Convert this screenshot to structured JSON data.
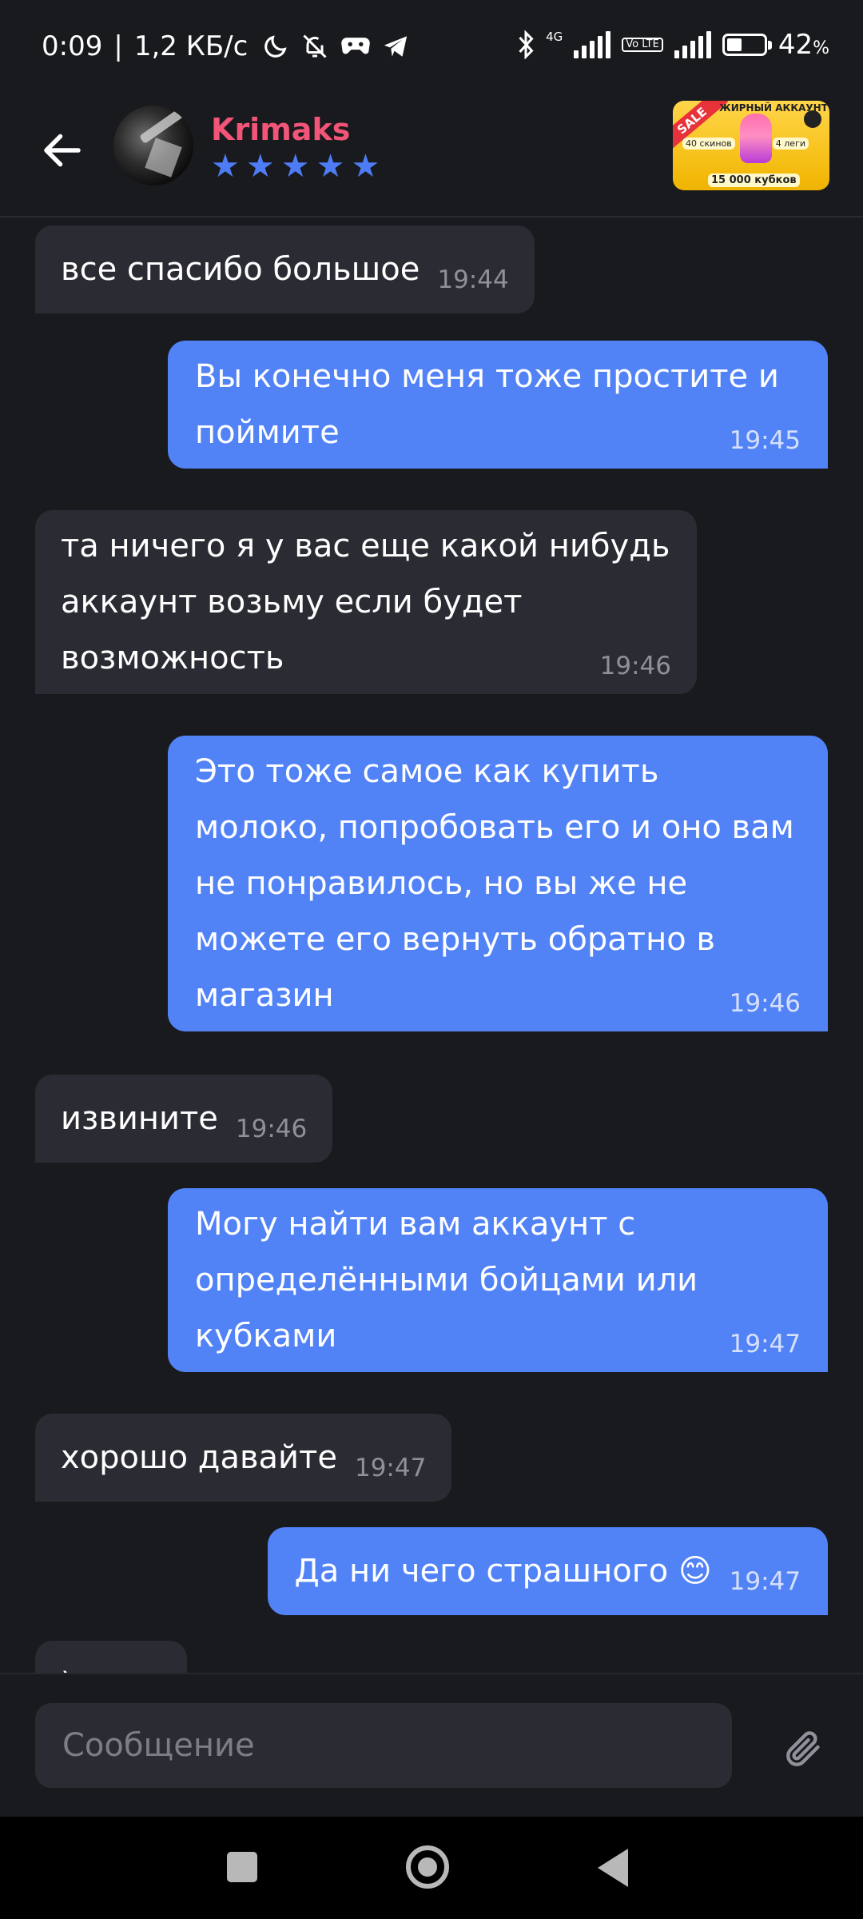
{
  "status_bar": {
    "time": "0:09",
    "separator": "|",
    "speed": "1,2 КБ/с",
    "network": "4G",
    "volte": "Vo LTE",
    "battery_percent": "42",
    "battery_percent_sign": "%",
    "battery_level": 0.42,
    "icons": [
      "moon-icon",
      "bell-off-icon",
      "gamepad-icon",
      "telegram-icon",
      "bluetooth-icon",
      "signal-icon",
      "signal-icon",
      "battery-icon"
    ]
  },
  "header": {
    "username": "Krimaks",
    "rating_stars": 5,
    "star_glyph": "★",
    "banner": {
      "sale": "SALE",
      "title": "ЖИРНЫЙ АККАУНТ",
      "left": "40 скинов",
      "right": "4 леги",
      "bottom": "15 000 кубков"
    }
  },
  "messages": [
    {
      "dir": "in",
      "text": "все спасибо большое",
      "time": "19:44"
    },
    {
      "dir": "out",
      "text": "Вы конечно меня тоже простите и поймите",
      "time": "19:45"
    },
    {
      "dir": "in",
      "text": "та ничего я у вас еще какой нибудь аккаунт возьму если будет возможность",
      "time": "19:46"
    },
    {
      "dir": "out",
      "text": "Это тоже самое как купить молоко, попробовать его и оно вам не понравилось, но вы же не можете его вернуть обратно в магазин",
      "time": "19:46"
    },
    {
      "dir": "in",
      "text": "извините",
      "time": "19:46"
    },
    {
      "dir": "out",
      "text": "Могу найти вам аккаунт с определёнными бойцами или кубками",
      "time": "19:47"
    },
    {
      "dir": "in",
      "text": "хорошо давайте",
      "time": "19:47"
    },
    {
      "dir": "out",
      "text": "Да ни чего страшного 😊",
      "time": "19:47"
    },
    {
      "dir": "in",
      "text": ")",
      "time": ""
    }
  ],
  "composer": {
    "placeholder": "Сообщение"
  },
  "colors": {
    "background": "#191a1e",
    "incoming_bubble": "#2b2c33",
    "outgoing_bubble": "#5183f7",
    "username": "#f25578",
    "stars": "#4d7cf5"
  }
}
